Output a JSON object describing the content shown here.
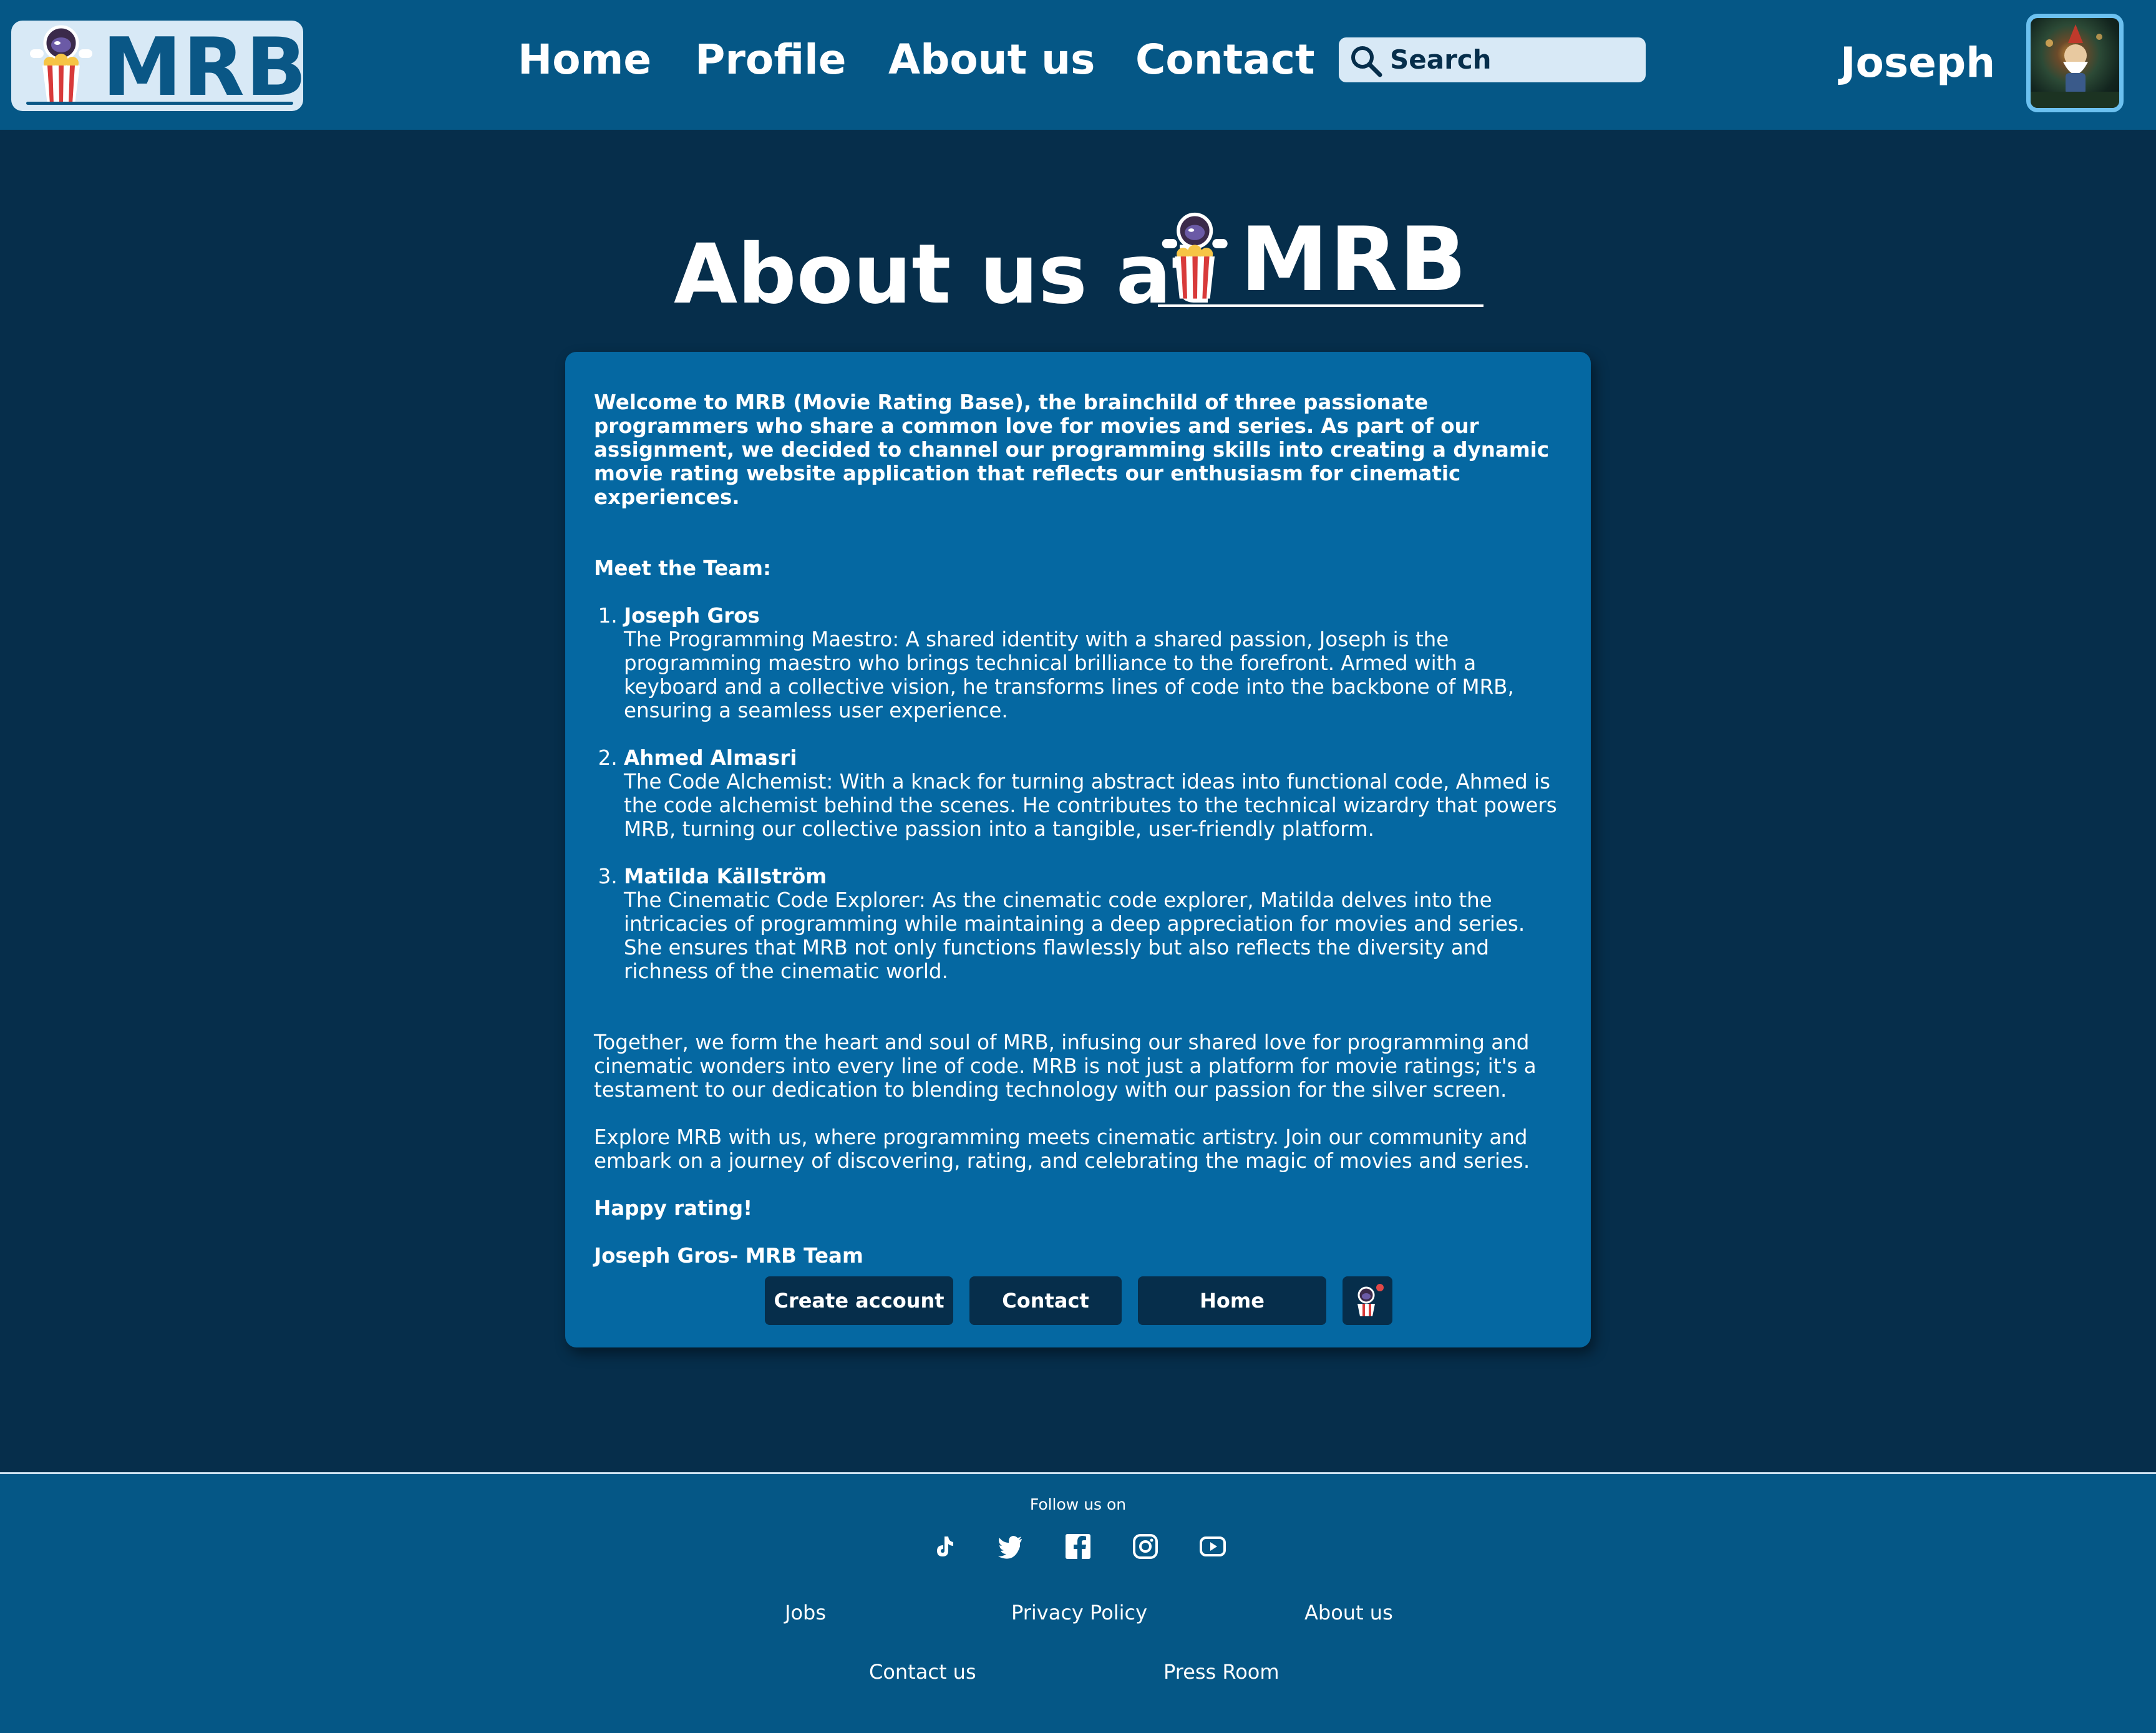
{
  "header": {
    "logo_text": "MRB",
    "nav": [
      "Home",
      "Profile",
      "About us",
      "Contact"
    ],
    "search_placeholder": "Search",
    "username": "Joseph"
  },
  "page": {
    "title": "About us at",
    "title_logo_text": "MRB"
  },
  "about": {
    "intro": "Welcome to MRB (Movie Rating Base), the brainchild of three passionate programmers who share a common love for movies and series. As part of our assignment, we decided to channel our programming skills into creating a dynamic movie rating website application that reflects our enthusiasm for cinematic experiences.",
    "team_heading": "Meet the Team:",
    "team": [
      {
        "name": "Joseph Gros",
        "description": "The Programming Maestro: A shared identity with a shared passion, Joseph is the programming maestro who brings technical brilliance to the forefront. Armed with a keyboard and a collective vision, he transforms lines of code into the backbone of MRB, ensuring a seamless user experience."
      },
      {
        "name": "Ahmed Almasri",
        "description": "The Code Alchemist: With a knack for turning abstract ideas into functional code, Ahmed is the code alchemist behind the scenes. He contributes to the technical wizardry that powers MRB, turning our collective passion into a tangible, user-friendly platform."
      },
      {
        "name": "Matilda Källström",
        "description": "The Cinematic Code Explorer: As the cinematic code explorer, Matilda delves into the intricacies of programming while maintaining a deep appreciation for movies and series. She ensures that MRB not only functions flawlessly but also reflects the diversity and richness of the cinematic world."
      }
    ],
    "together": "Together, we form the heart and soul of MRB, infusing our shared love for programming and cinematic wonders into every line of code. MRB is not just a platform for movie ratings; it's a testament to our dedication to blending technology with our passion for the silver screen.",
    "explore": "Explore MRB with us, where programming meets cinematic artistry. Join our community and embark on a journey of discovering, rating, and celebrating the magic of movies and series.",
    "closing": "Happy rating!",
    "signature": "Joseph Gros- MRB Team",
    "buttons": {
      "create_account": "Create account",
      "contact": "Contact",
      "home": "Home"
    }
  },
  "footer": {
    "follow": "Follow us on",
    "social_icons": [
      "tiktok-icon",
      "twitter-icon",
      "facebook-icon",
      "instagram-icon",
      "youtube-icon"
    ],
    "links": [
      "Jobs",
      "Privacy Policy",
      "About us",
      "Contact us",
      "Press Room"
    ]
  },
  "colors": {
    "background": "#062e4b",
    "header": "#055786",
    "card": "#0568a2",
    "button": "#062e4b",
    "search_bg": "#d8e9f6",
    "avatar_border": "#6cc1f0"
  }
}
